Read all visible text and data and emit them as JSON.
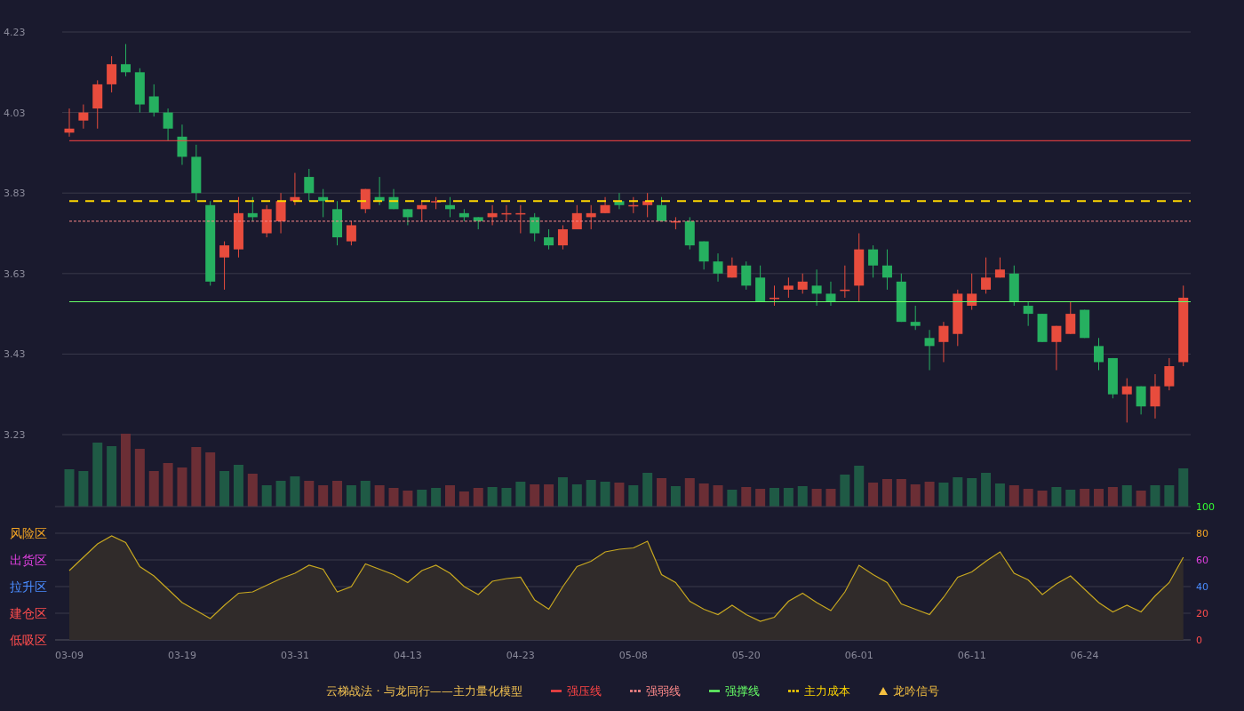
{
  "price_chart": {
    "chart_data": {
      "type": "candlestick",
      "categories": [
        null,
        null,
        null,
        null,
        null,
        null,
        null,
        null,
        null,
        null,
        null,
        null,
        null,
        null,
        null,
        null,
        null,
        null,
        null,
        null,
        null,
        null,
        null,
        null,
        null,
        null,
        null,
        null,
        null,
        null,
        null,
        null,
        null,
        null,
        null,
        null,
        null,
        null,
        null,
        null,
        null,
        null,
        null,
        null,
        null,
        null,
        null,
        null,
        null,
        null,
        null,
        null,
        null,
        null,
        null,
        null,
        null,
        null,
        null,
        null,
        null,
        null,
        null,
        null,
        null,
        null,
        null,
        null,
        null,
        null,
        null,
        null,
        null,
        null,
        null,
        null,
        null,
        null,
        null,
        null
      ],
      "ohlc": [
        [
          3.98,
          4.04,
          3.97,
          3.99
        ],
        [
          4.01,
          4.05,
          3.99,
          4.03
        ],
        [
          4.04,
          4.11,
          3.99,
          4.1
        ],
        [
          4.1,
          4.17,
          4.08,
          4.15
        ],
        [
          4.15,
          4.2,
          4.12,
          4.13
        ],
        [
          4.13,
          4.14,
          4.03,
          4.05
        ],
        [
          4.07,
          4.1,
          4.02,
          4.03
        ],
        [
          4.03,
          4.04,
          3.96,
          3.99
        ],
        [
          3.97,
          4.0,
          3.9,
          3.92
        ],
        [
          3.92,
          3.95,
          3.81,
          3.83
        ],
        [
          3.8,
          3.81,
          3.6,
          3.61
        ],
        [
          3.67,
          3.71,
          3.59,
          3.7
        ],
        [
          3.69,
          3.82,
          3.67,
          3.78
        ],
        [
          3.78,
          3.82,
          3.76,
          3.77
        ],
        [
          3.73,
          3.8,
          3.72,
          3.79
        ],
        [
          3.76,
          3.83,
          3.73,
          3.81
        ],
        [
          3.81,
          3.88,
          3.8,
          3.82
        ],
        [
          3.87,
          3.89,
          3.81,
          3.83
        ],
        [
          3.82,
          3.84,
          3.77,
          3.81
        ],
        [
          3.79,
          3.81,
          3.7,
          3.72
        ],
        [
          3.71,
          3.76,
          3.7,
          3.75
        ],
        [
          3.79,
          3.84,
          3.78,
          3.84
        ],
        [
          3.82,
          3.87,
          3.8,
          3.81
        ],
        [
          3.82,
          3.84,
          3.79,
          3.79
        ],
        [
          3.79,
          3.79,
          3.75,
          3.77
        ],
        [
          3.79,
          3.81,
          3.76,
          3.8
        ],
        [
          3.81,
          3.82,
          3.79,
          3.81
        ],
        [
          3.8,
          3.82,
          3.77,
          3.79
        ],
        [
          3.78,
          3.79,
          3.76,
          3.77
        ],
        [
          3.77,
          3.77,
          3.74,
          3.76
        ],
        [
          3.77,
          3.8,
          3.75,
          3.78
        ],
        [
          3.78,
          3.8,
          3.76,
          3.78
        ],
        [
          3.78,
          3.8,
          3.73,
          3.78
        ],
        [
          3.77,
          3.78,
          3.71,
          3.73
        ],
        [
          3.72,
          3.74,
          3.69,
          3.7
        ],
        [
          3.7,
          3.75,
          3.69,
          3.74
        ],
        [
          3.74,
          3.8,
          3.74,
          3.78
        ],
        [
          3.77,
          3.8,
          3.74,
          3.78
        ],
        [
          3.78,
          3.82,
          3.78,
          3.8
        ],
        [
          3.81,
          3.83,
          3.79,
          3.8
        ],
        [
          3.8,
          3.82,
          3.78,
          3.8
        ],
        [
          3.8,
          3.83,
          3.77,
          3.81
        ],
        [
          3.8,
          3.82,
          3.76,
          3.76
        ],
        [
          3.76,
          3.77,
          3.74,
          3.76
        ],
        [
          3.76,
          3.77,
          3.69,
          3.7
        ],
        [
          3.71,
          3.71,
          3.64,
          3.66
        ],
        [
          3.66,
          3.68,
          3.61,
          3.63
        ],
        [
          3.62,
          3.67,
          3.62,
          3.65
        ],
        [
          3.65,
          3.66,
          3.59,
          3.6
        ],
        [
          3.62,
          3.65,
          3.56,
          3.56
        ],
        [
          3.57,
          3.6,
          3.55,
          3.57
        ],
        [
          3.59,
          3.62,
          3.57,
          3.6
        ],
        [
          3.59,
          3.63,
          3.58,
          3.61
        ],
        [
          3.6,
          3.64,
          3.55,
          3.58
        ],
        [
          3.58,
          3.61,
          3.55,
          3.56
        ],
        [
          3.59,
          3.65,
          3.57,
          3.59
        ],
        [
          3.6,
          3.73,
          3.56,
          3.69
        ],
        [
          3.69,
          3.7,
          3.62,
          3.65
        ],
        [
          3.65,
          3.69,
          3.59,
          3.62
        ],
        [
          3.61,
          3.63,
          3.51,
          3.51
        ],
        [
          3.51,
          3.55,
          3.49,
          3.5
        ],
        [
          3.47,
          3.49,
          3.39,
          3.45
        ],
        [
          3.46,
          3.51,
          3.41,
          3.5
        ],
        [
          3.48,
          3.59,
          3.45,
          3.58
        ],
        [
          3.55,
          3.63,
          3.54,
          3.58
        ],
        [
          3.59,
          3.67,
          3.58,
          3.62
        ],
        [
          3.62,
          3.67,
          3.62,
          3.64
        ],
        [
          3.63,
          3.65,
          3.55,
          3.56
        ],
        [
          3.55,
          3.56,
          3.5,
          3.53
        ],
        [
          3.53,
          3.53,
          3.46,
          3.46
        ],
        [
          3.46,
          3.5,
          3.39,
          3.5
        ],
        [
          3.48,
          3.56,
          3.48,
          3.53
        ],
        [
          3.54,
          3.54,
          3.47,
          3.47
        ],
        [
          3.45,
          3.47,
          3.39,
          3.41
        ],
        [
          3.42,
          3.42,
          3.32,
          3.33
        ],
        [
          3.33,
          3.37,
          3.26,
          3.35
        ],
        [
          3.35,
          3.35,
          3.28,
          3.3
        ],
        [
          3.3,
          3.38,
          3.27,
          3.35
        ],
        [
          3.35,
          3.42,
          3.34,
          3.4
        ],
        [
          3.41,
          3.6,
          3.4,
          3.57
        ]
      ],
      "ylim": [
        3.23,
        4.23
      ],
      "yticks": [
        4.23,
        4.03,
        3.83,
        3.63,
        3.43,
        3.23
      ],
      "grid": true
    }
  },
  "oscillator": {
    "zones": [
      {
        "label": "风险区",
        "color": "#f5a623"
      },
      {
        "label": "出货区",
        "color": "#e040e0"
      },
      {
        "label": "拉升区",
        "color": "#4a8cff"
      },
      {
        "label": "建仓区",
        "color": "#ff4d4d"
      },
      {
        "label": "低吸区",
        "color": "#ff4d4d"
      }
    ],
    "chart_data": {
      "type": "area",
      "categories": [
        "03-09",
        null,
        null,
        null,
        null,
        null,
        null,
        null,
        "03-19",
        null,
        null,
        null,
        null,
        null,
        null,
        null,
        "03-31",
        null,
        null,
        null,
        null,
        null,
        null,
        null,
        "04-13",
        null,
        null,
        null,
        null,
        null,
        null,
        null,
        "04-23",
        null,
        null,
        null,
        null,
        null,
        null,
        null,
        "05-08",
        null,
        null,
        null,
        null,
        null,
        null,
        null,
        "05-20",
        null,
        null,
        null,
        null,
        null,
        null,
        null,
        "06-01",
        null,
        null,
        null,
        null,
        null,
        null,
        null,
        "06-11",
        null,
        null,
        null,
        null,
        null,
        null,
        null,
        "06-24",
        null,
        null,
        null,
        null,
        null,
        null,
        null
      ],
      "series": [
        {
          "color": "#c8a820",
          "values": [
            52,
            62,
            72,
            78,
            73,
            55,
            48,
            38,
            28,
            22,
            16,
            26,
            35,
            36,
            41,
            46,
            50,
            56,
            53,
            36,
            40,
            57,
            53,
            49,
            43,
            52,
            56,
            50,
            40,
            34,
            44,
            46,
            47,
            30,
            23,
            40,
            55,
            59,
            66,
            68,
            69,
            74,
            49,
            43,
            29,
            23,
            19,
            26,
            19,
            14,
            17,
            29,
            35,
            28,
            22,
            36,
            56,
            49,
            43,
            27,
            23,
            19,
            32,
            47,
            51,
            59,
            66,
            50,
            45,
            34,
            42,
            48,
            38,
            28,
            21,
            26,
            21,
            33,
            43,
            62
          ]
        }
      ],
      "yticks": [
        0,
        20,
        40,
        60,
        80,
        100
      ],
      "ylim": [
        0,
        100
      ],
      "grid": true
    }
  },
  "legend": {
    "title": "云梯战法 · 与龙同行——主力量化模型",
    "items": [
      {
        "label": "强压线",
        "color": "#ff4444",
        "kind": "solid"
      },
      {
        "label": "强弱线",
        "color": "#ff8a8a",
        "kind": "dotted"
      },
      {
        "label": "强撑线",
        "color": "#66ff66",
        "kind": "solid"
      },
      {
        "label": "主力成本",
        "color": "#ffd700",
        "kind": "dashed"
      },
      {
        "label": "龙吟信号",
        "color": "#f5c040",
        "kind": "triangle"
      }
    ]
  }
}
